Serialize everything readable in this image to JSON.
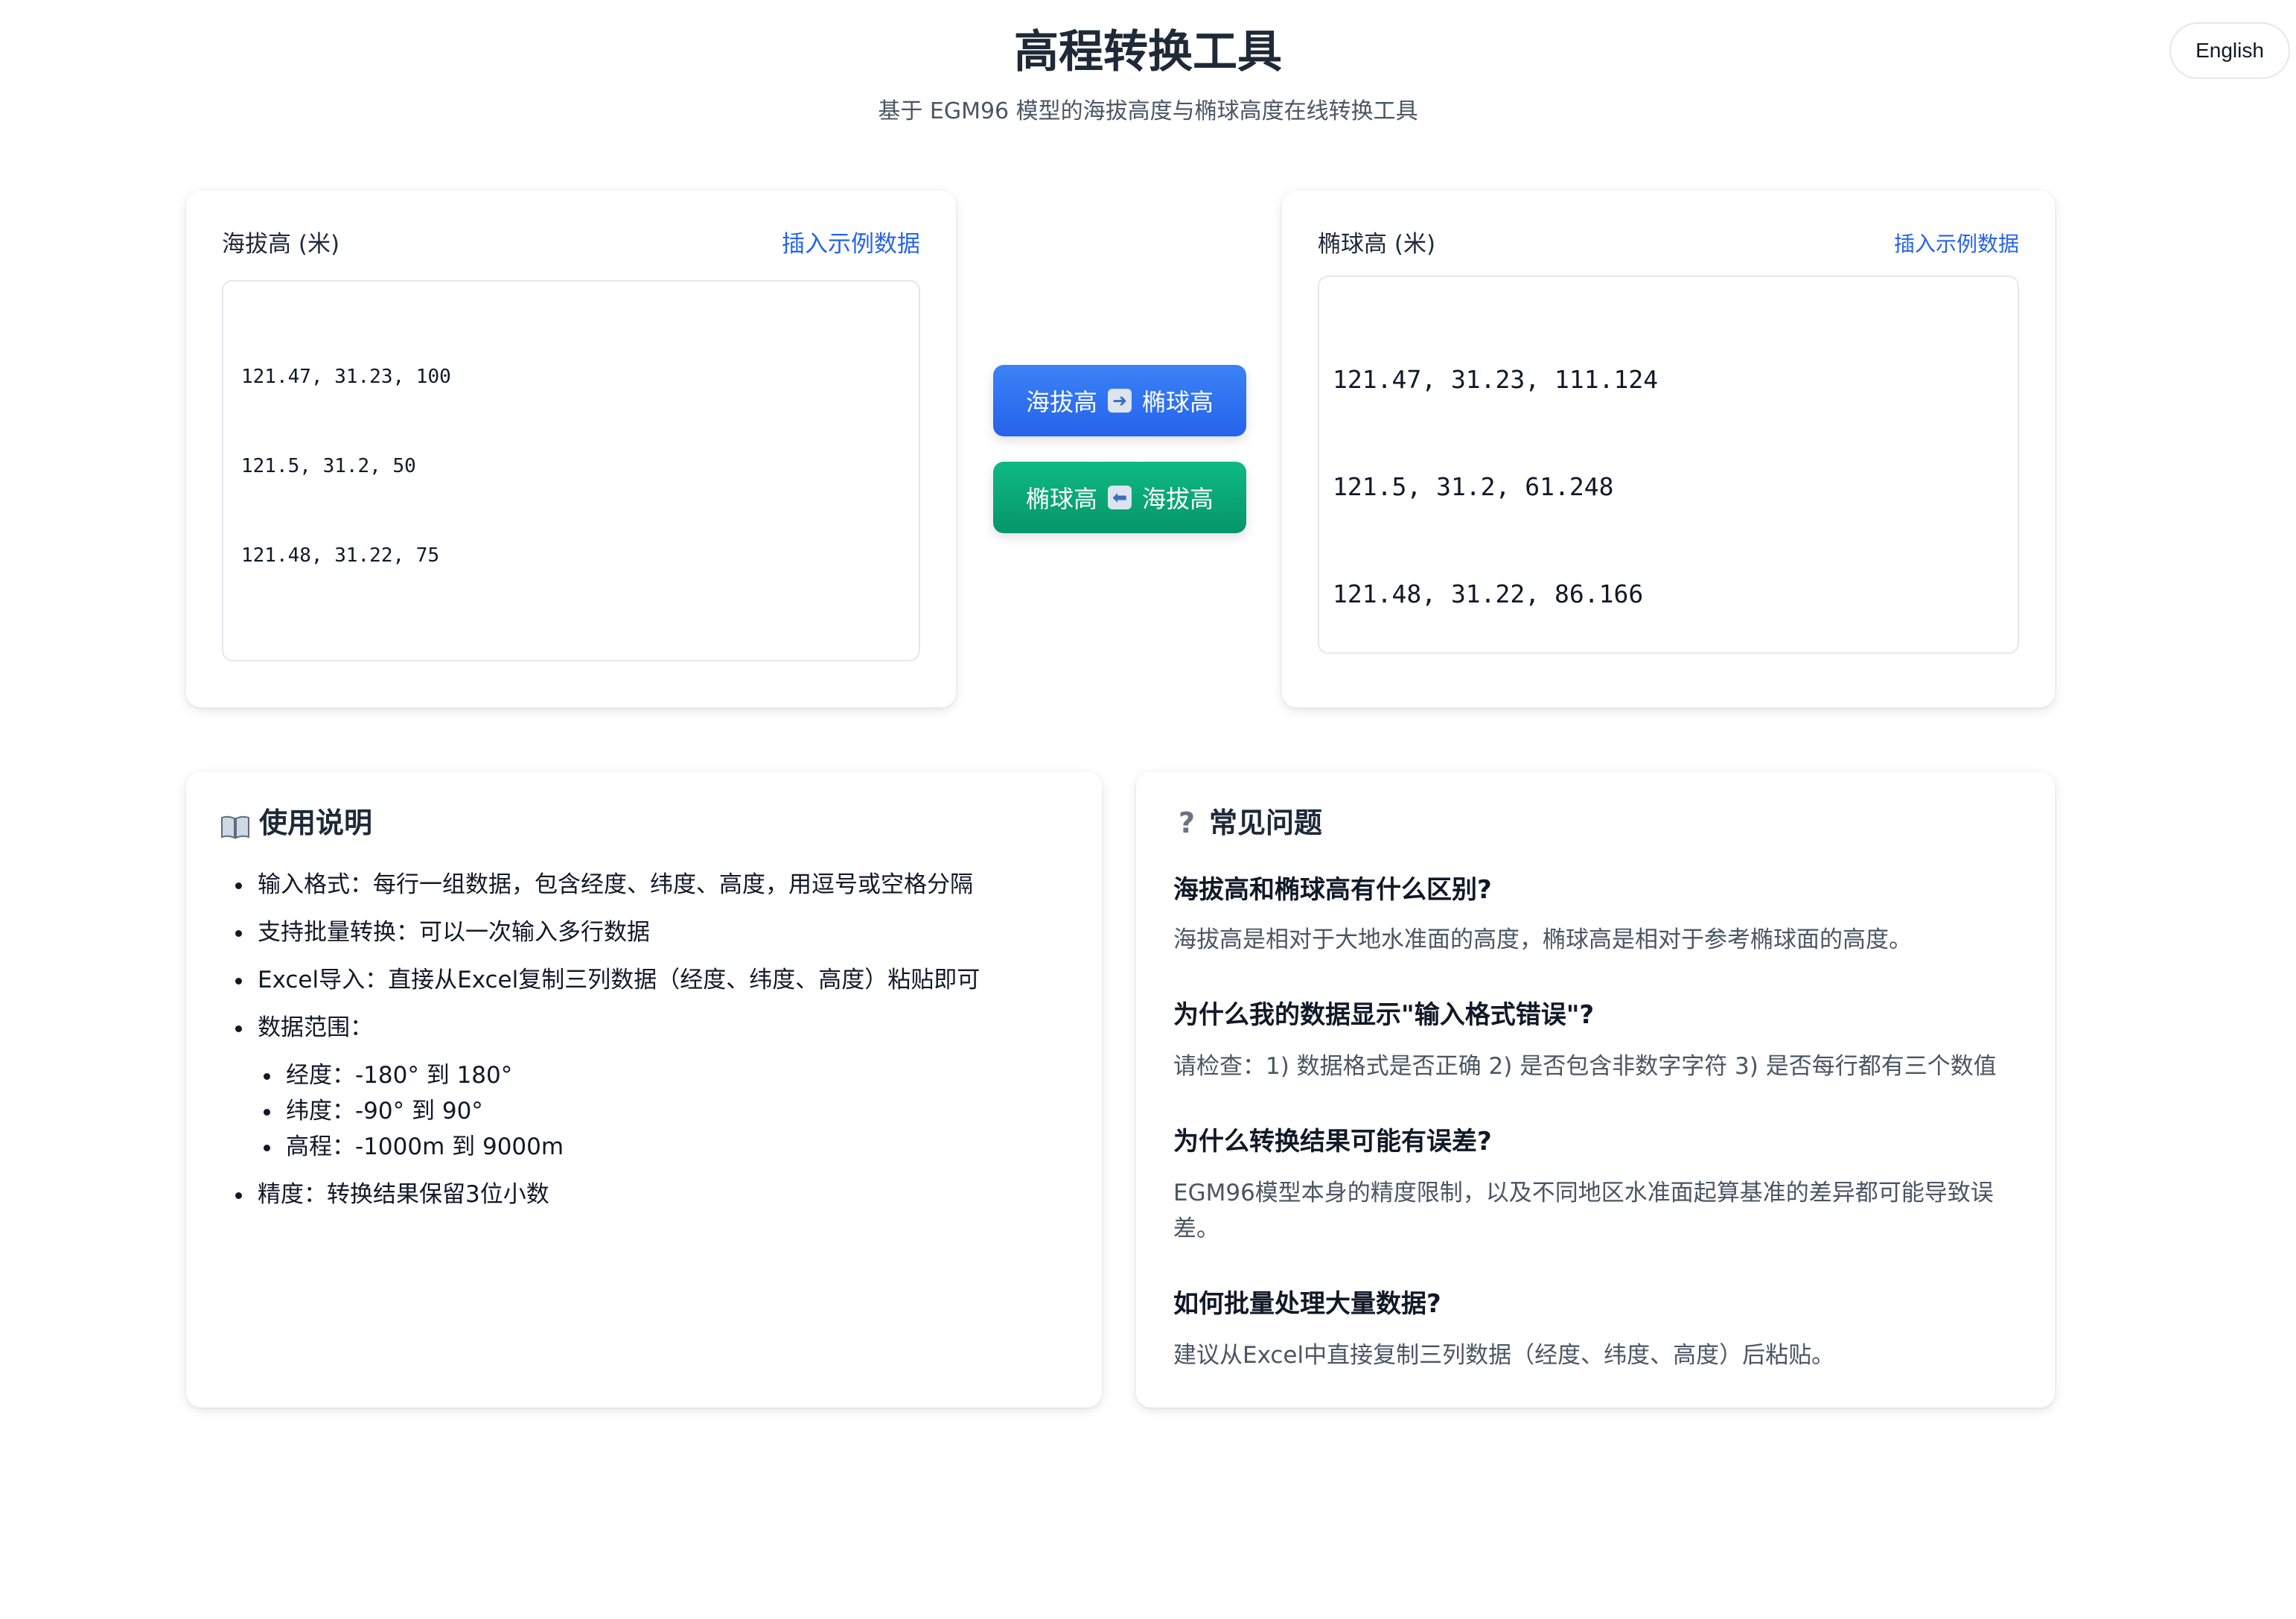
{
  "header": {
    "title": "高程转换工具",
    "subtitle": "基于 EGM96 模型的海拔高度与椭球高度在线转换工具",
    "language_button": "English"
  },
  "converter": {
    "left": {
      "label": "海拔高 (米)",
      "sample_link": "插入示例数据",
      "lines": [
        "121.47, 31.23, 100",
        "121.5, 31.2, 50",
        "121.48, 31.22, 75"
      ]
    },
    "right": {
      "label": "椭球高 (米)",
      "sample_link": "插入示例数据",
      "lines": [
        "121.47, 31.23, 111.124",
        "121.5, 31.2, 61.248",
        "121.48, 31.22, 86.166"
      ]
    },
    "buttons": {
      "to_ellipsoid_left": "海拔高",
      "to_ellipsoid_right": "椭球高",
      "to_orthometric_left": "椭球高",
      "to_orthometric_right": "海拔高"
    }
  },
  "instructions": {
    "title": "使用说明",
    "items": [
      "输入格式：每行一组数据，包含经度、纬度、高度，用逗号或空格分隔",
      "支持批量转换：可以一次输入多行数据",
      "Excel导入：直接从Excel复制三列数据（经度、纬度、高度）粘贴即可",
      "数据范围："
    ],
    "ranges": [
      "经度：-180° 到 180°",
      "纬度：-90° 到 90°",
      "高程：-1000m 到 9000m"
    ],
    "precision": "精度：转换结果保留3位小数"
  },
  "faq": {
    "title": "常见问题",
    "items": [
      {
        "q": "海拔高和椭球高有什么区别?",
        "a": "海拔高是相对于大地水准面的高度，椭球高是相对于参考椭球面的高度。"
      },
      {
        "q": "为什么我的数据显示\"输入格式错误\"?",
        "a": "请检查：1) 数据格式是否正确 2) 是否包含非数字字符 3) 是否每行都有三个数值"
      },
      {
        "q": "为什么转换结果可能有误差?",
        "a": "EGM96模型本身的精度限制，以及不同地区水准面起算基准的差异都可能导致误差。"
      },
      {
        "q": "如何批量处理大量数据?",
        "a": "建议从Excel中直接复制三列数据（经度、纬度、高度）后粘贴。"
      }
    ]
  }
}
